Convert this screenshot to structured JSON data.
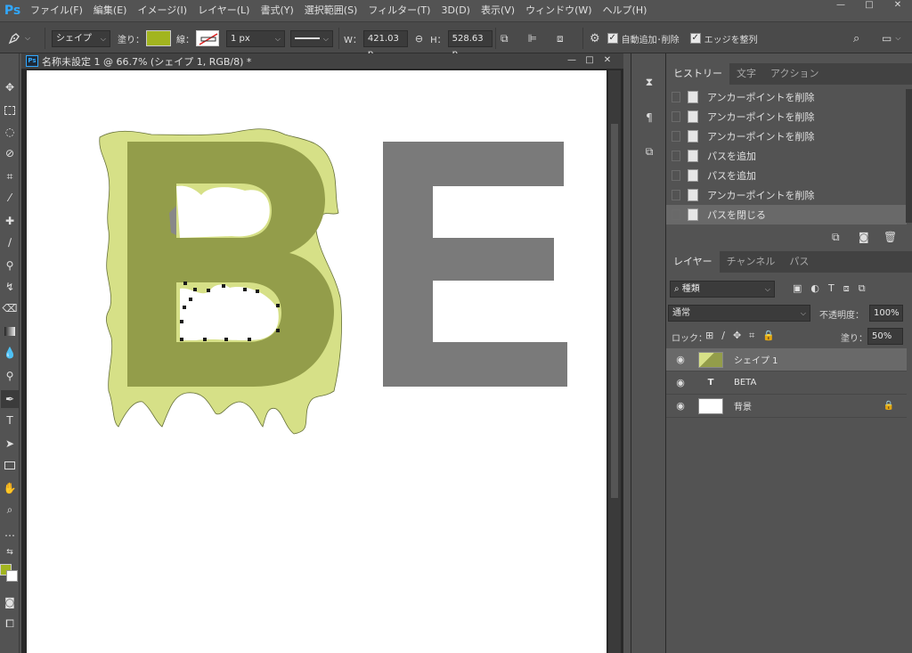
{
  "app": {
    "logo": "Ps"
  },
  "menu": [
    "ファイル(F)",
    "編集(E)",
    "イメージ(I)",
    "レイヤー(L)",
    "書式(Y)",
    "選択範囲(S)",
    "フィルター(T)",
    "3D(D)",
    "表示(V)",
    "ウィンドウ(W)",
    "ヘルプ(H)"
  ],
  "window_controls": {
    "minimize": "—",
    "maximize": "□",
    "close": "✕"
  },
  "options": {
    "mode": "シェイプ",
    "fill_label": "塗り：",
    "fill_color": "#a2b51f",
    "stroke_label": "線：",
    "stroke_width": "1 px",
    "w_label": "W：",
    "w_value": "421.03 p",
    "h_label": "H：",
    "h_value": "528.63 p",
    "auto_add_delete": "自動追加･削除",
    "align_edges": "エッジを整列"
  },
  "document": {
    "tab_title": "名称未設定 1 @ 66.7% (シェイプ 1, RGB/8) *",
    "letter_b": "B",
    "letter_e": "E",
    "b_color": "#939d4a",
    "b_back_color": "#d6e087",
    "e_color": "#7a7a7a"
  },
  "colors": {
    "foreground": "#a2b51f",
    "background": "#ffffff"
  },
  "history_panel": {
    "tabs": [
      "ヒストリー",
      "文字",
      "アクション"
    ],
    "items": [
      "アンカーポイントを削除",
      "アンカーポイントを削除",
      "アンカーポイントを削除",
      "パスを追加",
      "パスを追加",
      "アンカーポイントを削除",
      "パスを閉じる"
    ],
    "current_index": 6
  },
  "layers_panel": {
    "tabs": [
      "レイヤー",
      "チャンネル",
      "パス"
    ],
    "filter_label": "種類",
    "blend_mode": "通常",
    "opacity_label": "不透明度：",
    "opacity": "100%",
    "lock_label": "ロック：",
    "fill_label": "塗り：",
    "fill": "50%",
    "layers": [
      {
        "name": "シェイプ 1",
        "type": "shape"
      },
      {
        "name": "BETA",
        "type": "text"
      },
      {
        "name": "背景",
        "type": "background"
      }
    ],
    "selected_index": 0
  }
}
